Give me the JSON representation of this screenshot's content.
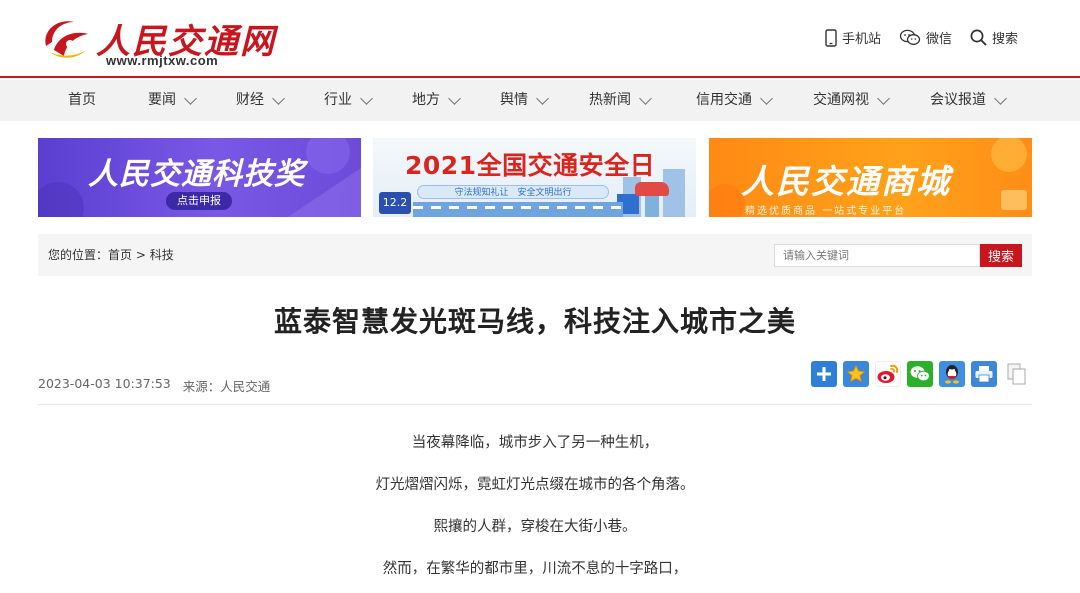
{
  "header": {
    "logo_text": "人民交通网",
    "logo_url": "www.rmjtxw.com",
    "links": [
      {
        "icon": "mobile-icon",
        "label": "手机站"
      },
      {
        "icon": "wechat-icon",
        "label": "微信"
      },
      {
        "icon": "search-icon",
        "label": "搜索"
      }
    ]
  },
  "nav": {
    "items": [
      {
        "label": "首页",
        "dropdown": false
      },
      {
        "label": "要闻",
        "dropdown": true
      },
      {
        "label": "财经",
        "dropdown": true
      },
      {
        "label": "行业",
        "dropdown": true
      },
      {
        "label": "地方",
        "dropdown": true
      },
      {
        "label": "舆情",
        "dropdown": true
      },
      {
        "label": "热新闻",
        "dropdown": true
      },
      {
        "label": "信用交通",
        "dropdown": true
      },
      {
        "label": "交通网视",
        "dropdown": true
      },
      {
        "label": "会议报道",
        "dropdown": true
      }
    ]
  },
  "banners": {
    "b1": {
      "title": "人民交通科技奖",
      "button": "点击申报"
    },
    "b2": {
      "title": "2021全国交通安全日",
      "slogan": "守法规知礼让　安全文明出行",
      "date": "12.2"
    },
    "b3": {
      "title": "人民交通商城",
      "subtitle": "精选优质商品 一站式专业平台"
    }
  },
  "breadcrumb": {
    "prefix": "您的位置：",
    "home": "首页",
    "separator": " > ",
    "current": "科技"
  },
  "search": {
    "placeholder": "请输入关键词",
    "button": "搜索"
  },
  "article": {
    "title": "蓝泰智慧发光斑马线，科技注入城市之美",
    "datetime": "2023-04-03 10:37:53",
    "source": "来源：人民交通",
    "paragraphs": [
      "当夜幕降临，城市步入了另一种生机，",
      "灯光熠熠闪烁，霓虹灯光点缀在城市的各个角落。",
      "熙攘的人群，穿梭在大街小巷。",
      "然而，在繁华的都市里，川流不息的十字路口，"
    ]
  },
  "colors": {
    "brand_red": "#c9151e",
    "nav_bg": "#f2f2f2",
    "crumb_bg": "#f5f5f5"
  }
}
